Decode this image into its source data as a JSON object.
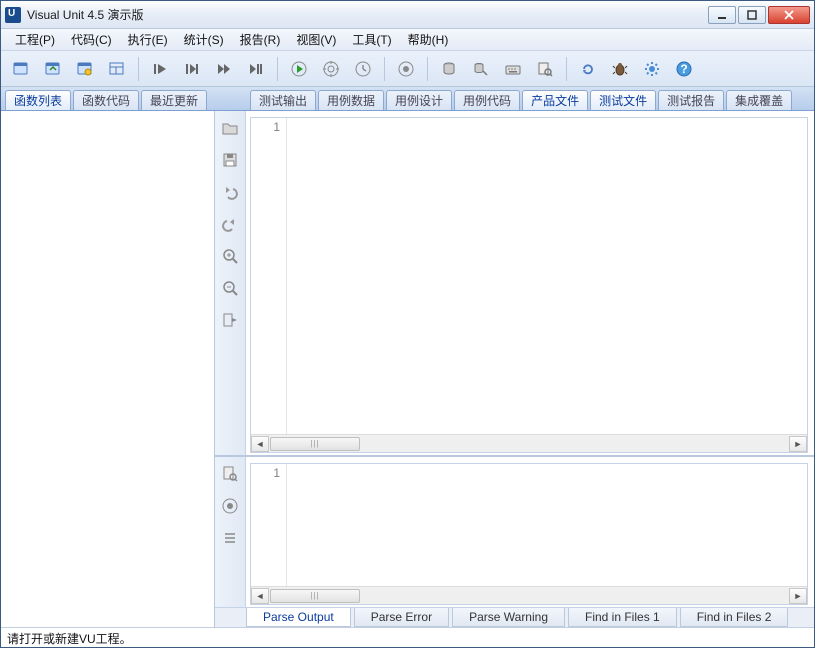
{
  "window": {
    "title": "Visual Unit 4.5 演示版"
  },
  "menu": {
    "items": [
      "工程(P)",
      "代码(C)",
      "执行(E)",
      "统计(S)",
      "报告(R)",
      "视图(V)",
      "工具(T)",
      "帮助(H)"
    ]
  },
  "toolbar_icons": [
    "new-window",
    "open-window",
    "recent-window",
    "layout",
    "sep",
    "play-first",
    "play-next",
    "play-skip",
    "play-jump",
    "sep",
    "run",
    "target",
    "clock",
    "sep",
    "record",
    "sep",
    "db",
    "db-link",
    "keyboard",
    "inspect",
    "sep",
    "refresh",
    "bug",
    "gear",
    "help"
  ],
  "left_tabs": {
    "items": [
      "函数列表",
      "函数代码",
      "最近更新"
    ],
    "active_index": 0
  },
  "right_tabs": {
    "items": [
      "测试输出",
      "用例数据",
      "用例设计",
      "用例代码",
      "产品文件",
      "测试文件",
      "测试报告",
      "集成覆盖"
    ],
    "active_index": 4,
    "secondary_active_index": 5
  },
  "editor_top": {
    "line_number": "1"
  },
  "editor_bottom": {
    "line_number": "1"
  },
  "bottom_tabs": {
    "items": [
      "Parse Output",
      "Parse Error",
      "Parse Warning",
      "Find in Files 1",
      "Find in Files 2"
    ],
    "active_index": 0
  },
  "status": {
    "text": "请打开或新建VU工程。"
  },
  "side_icons_top": [
    "folder",
    "save",
    "undo",
    "redo",
    "zoom-in",
    "zoom-out",
    "goto"
  ],
  "side_icons_bottom": [
    "search-doc",
    "record-circle",
    "list"
  ]
}
